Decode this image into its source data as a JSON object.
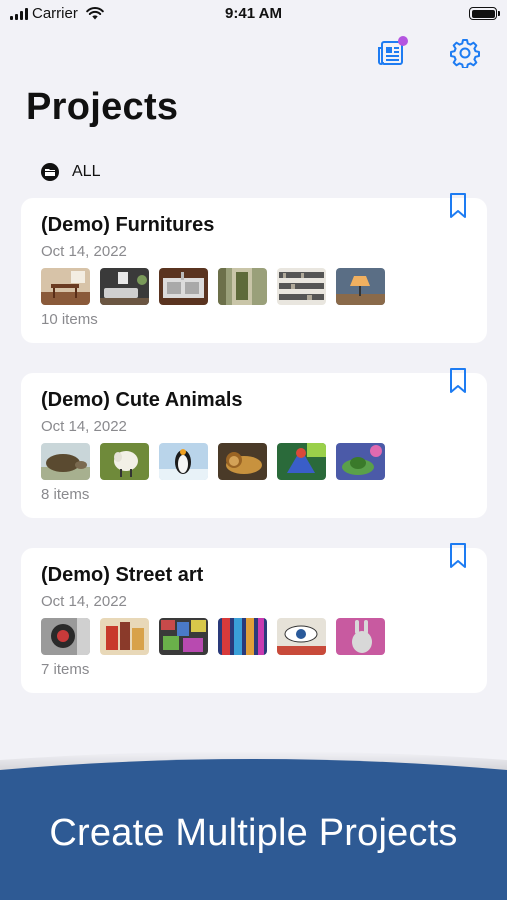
{
  "status_bar": {
    "carrier": "Carrier",
    "time": "9:41 AM"
  },
  "header": {
    "title": "Projects",
    "filter_label": "ALL",
    "notification_badge_color": "#b455e0",
    "accent_color": "#1e7cf2"
  },
  "projects": [
    {
      "title": "(Demo) Furnitures",
      "date": "Oct 14, 2022",
      "count": "10 items",
      "thumbs": [
        "dining-room",
        "living-room",
        "kitchen-sink",
        "hallway",
        "bookshelf",
        "lamp"
      ]
    },
    {
      "title": "(Demo) Cute Animals",
      "date": "Oct 14, 2022",
      "count": "8 items",
      "thumbs": [
        "turtle",
        "sheep",
        "penguin",
        "lion",
        "parrot",
        "frog"
      ]
    },
    {
      "title": "(Demo) Street art",
      "date": "Oct 14, 2022",
      "count": "7 items",
      "thumbs": [
        "graffiti-face",
        "mural-figures",
        "collage-wall",
        "colorful-wall",
        "eye-mural",
        "rabbit-mural"
      ]
    }
  ],
  "banner": {
    "text": "Create Multiple Projects",
    "color": "#2e5a94"
  }
}
